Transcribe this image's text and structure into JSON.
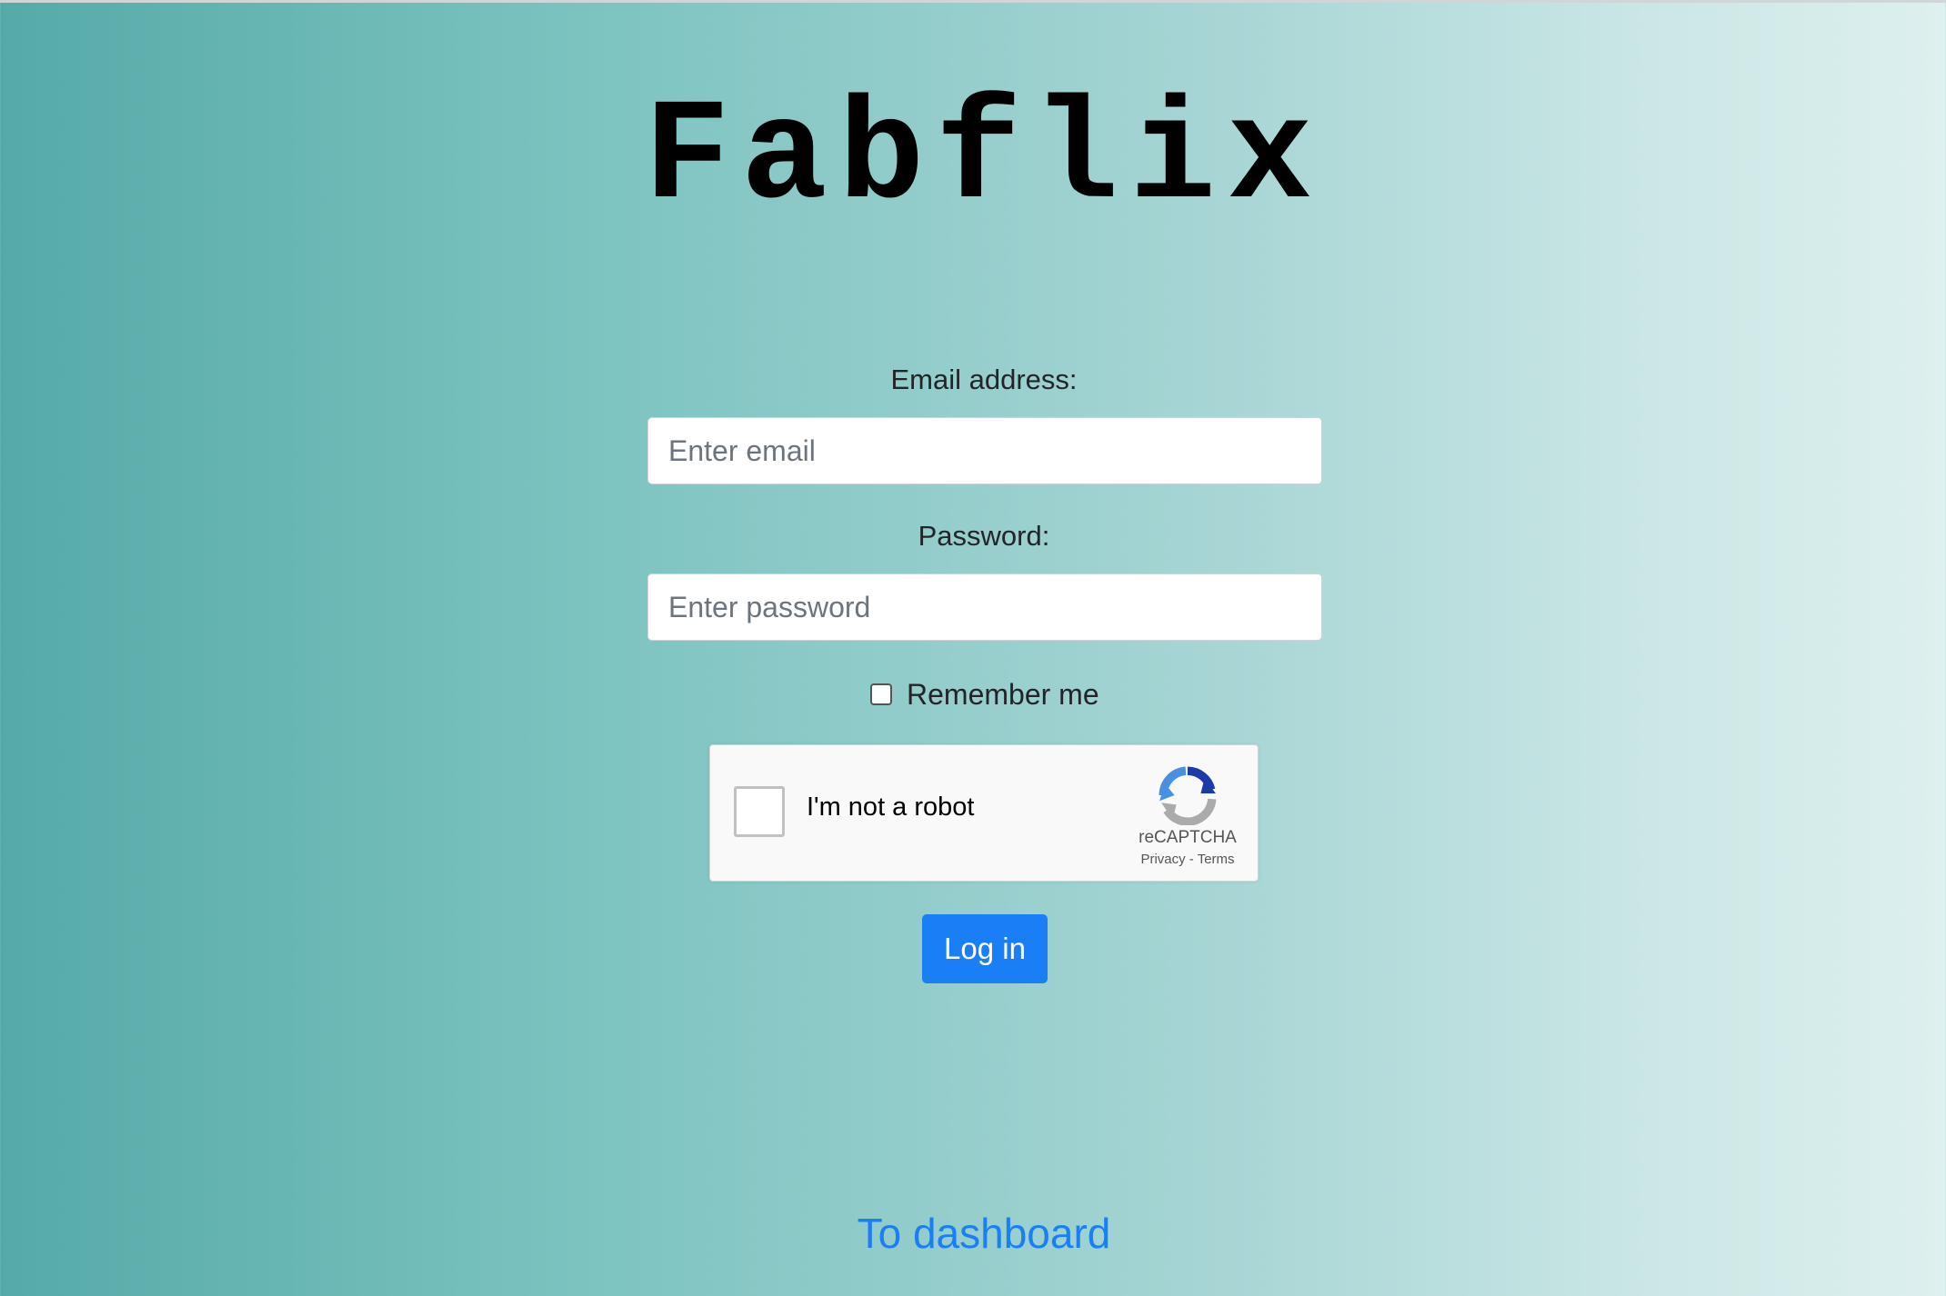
{
  "page": {
    "title": "Fabflix"
  },
  "login_form": {
    "email_label": "Email address:",
    "email_placeholder": "Enter email",
    "email_value": "",
    "password_label": "Password:",
    "password_placeholder": "Enter password",
    "password_value": "",
    "remember_label": "Remember me",
    "remember_checked": false,
    "submit_label": "Log in"
  },
  "captcha": {
    "label": "I'm not a robot",
    "brand": "reCAPTCHA",
    "privacy_link": "Privacy",
    "separator": "-",
    "terms_link": "Terms",
    "icon": "recaptcha-logo-icon"
  },
  "footer": {
    "dashboard_link": "To dashboard"
  },
  "colors": {
    "gradient_left": "#55aaa8",
    "gradient_right": "#def0ef",
    "primary_button": "#1a7ef4",
    "link": "#1a7ef4",
    "title_text": "#000000"
  }
}
